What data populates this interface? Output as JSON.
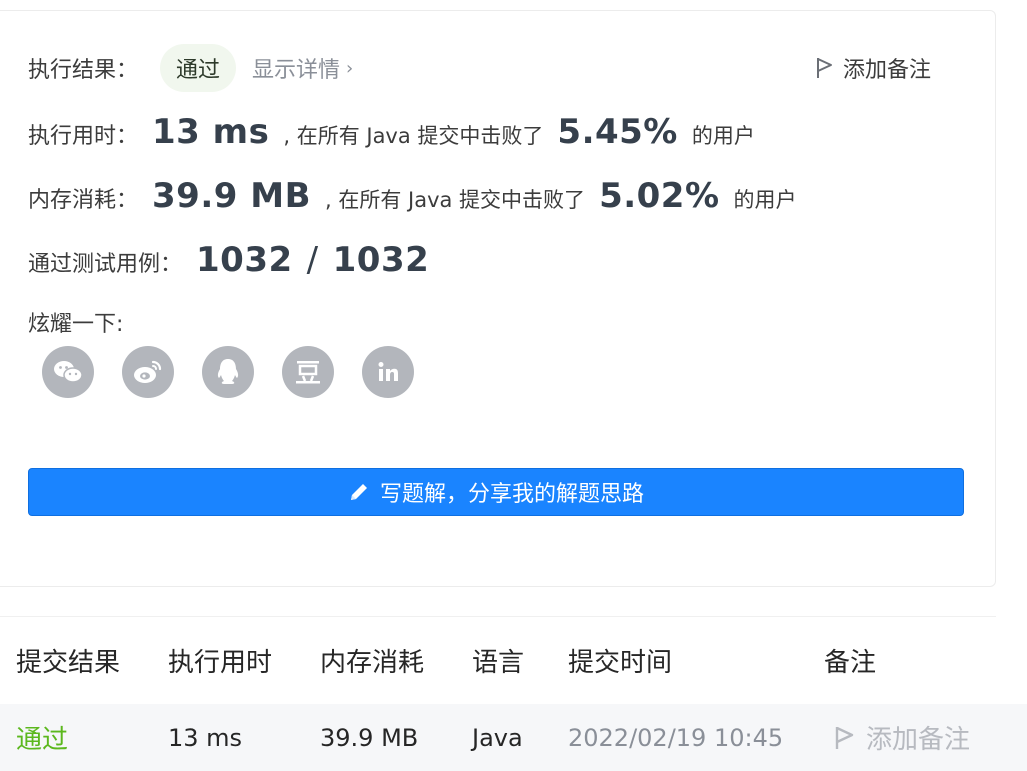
{
  "result": {
    "label": "执行结果：",
    "status": "通过",
    "detail_link": "显示详情",
    "add_note": "添加备注"
  },
  "runtime": {
    "label": "执行用时：",
    "value": "13 ms",
    "mid_text": ", 在所有 Java 提交中击败了",
    "percent": "5.45%",
    "suffix": "的用户"
  },
  "memory": {
    "label": "内存消耗：",
    "value": "39.9 MB",
    "mid_text": ", 在所有 Java 提交中击败了",
    "percent": "5.02%",
    "suffix": "的用户"
  },
  "tests": {
    "label": "通过测试用例：",
    "passed": "1032",
    "separator": "/",
    "total": "1032"
  },
  "share": {
    "label": "炫耀一下:",
    "icons": [
      "wechat-icon",
      "weibo-icon",
      "qq-icon",
      "douban-icon",
      "linkedin-icon"
    ]
  },
  "write_button": {
    "label": "写题解，分享我的解题思路"
  },
  "table": {
    "headers": [
      "提交结果",
      "执行用时",
      "内存消耗",
      "语言",
      "提交时间",
      "备注"
    ],
    "rows": [
      {
        "status": "通过",
        "runtime": "13 ms",
        "memory": "39.9 MB",
        "language": "Java",
        "time": "2022/02/19 10:45",
        "note": "添加备注"
      }
    ]
  },
  "colors": {
    "accent": "#1a84ff",
    "pass_green": "#5cb81e",
    "icon_gray": "#b3b6bc"
  }
}
